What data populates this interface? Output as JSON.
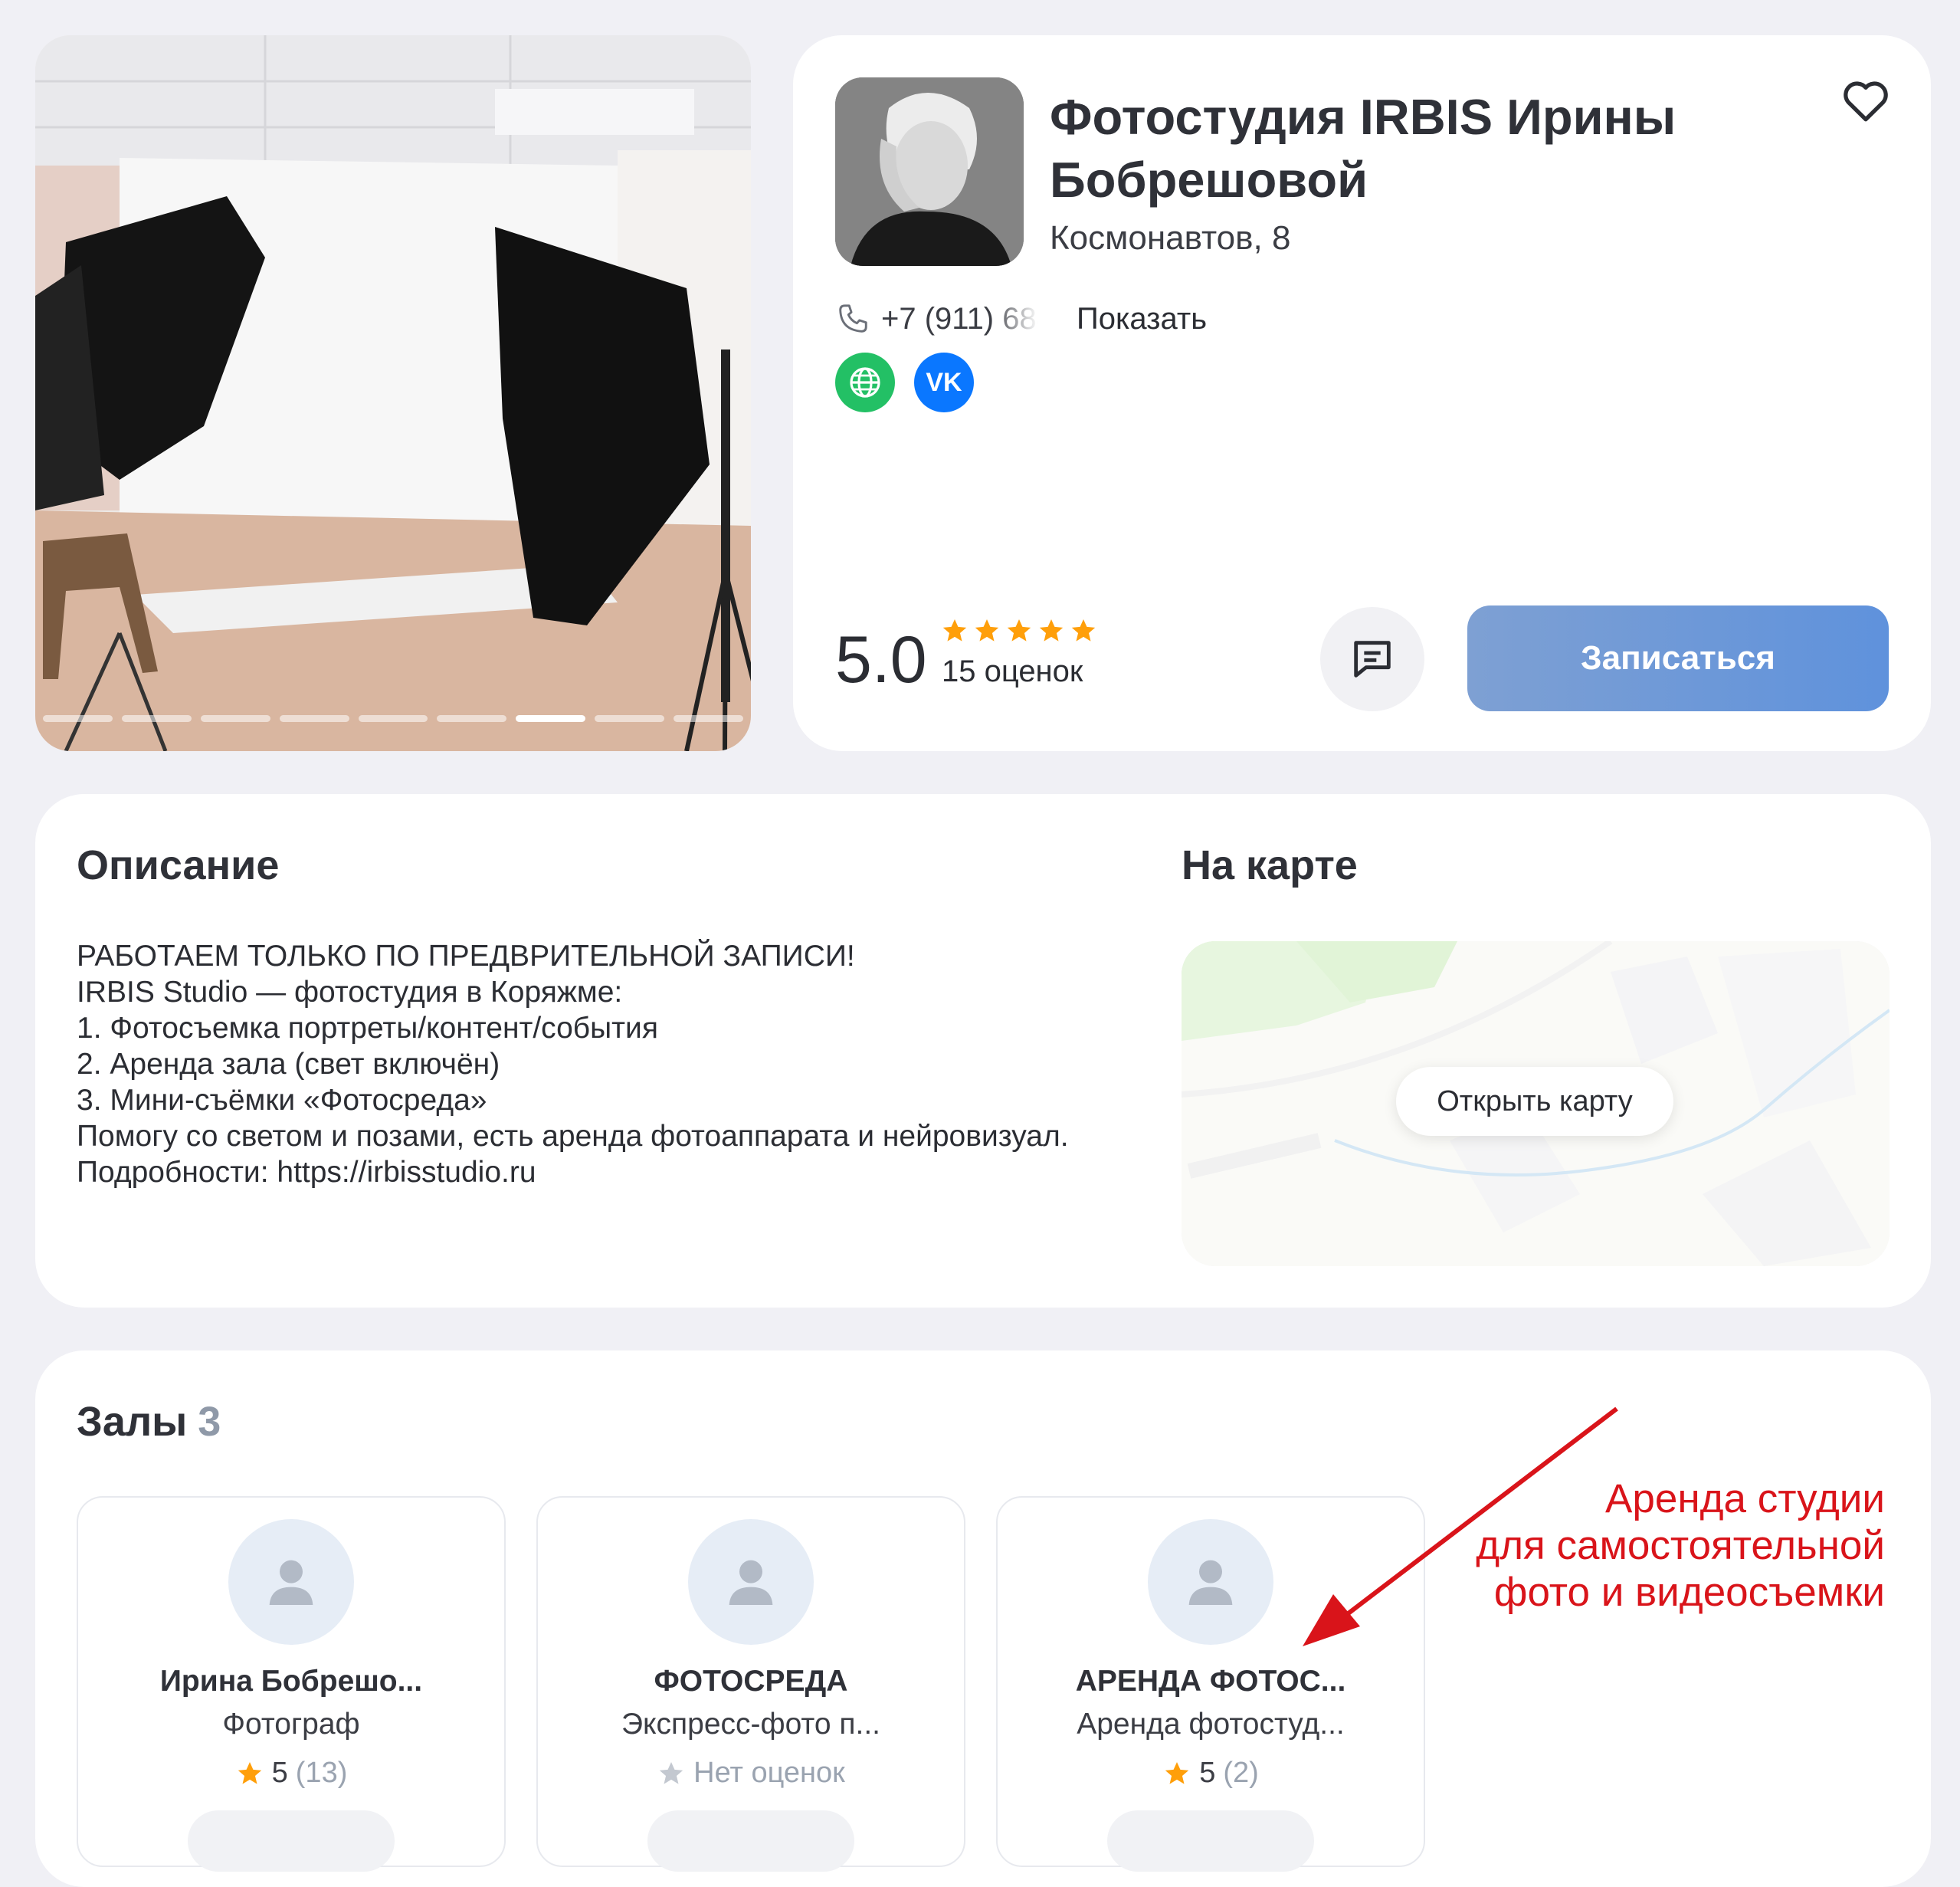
{
  "hero": {
    "slides_total": 9,
    "active_slide": 7
  },
  "studio": {
    "name": "Фотостудия IRBIS Ирины Бобрешовой",
    "address": "Космонавтов, 8",
    "phone_partial": "+7 (911) 684",
    "show_phone_label": "Показать",
    "links": [
      "globe-icon",
      "vk-icon"
    ],
    "vk_label": "VK",
    "rating": "5.0",
    "stars": 5,
    "reviews_label": "15 оценок",
    "book_label": "Записаться",
    "colors": {
      "accent": "#5f92dc",
      "star": "#ff9f0a",
      "site": "#23c065",
      "vk": "#0a77ff"
    }
  },
  "description": {
    "title": "Описание",
    "lines": [
      "РАБОТАЕМ ТОЛЬКО ПО ПРЕДВРИТЕЛЬНОЙ ЗАПИСИ!",
      "IRBIS Studio — фотостудия в Коряжме:",
      "1. Фотосъемка портреты/контент/события",
      "2. Аренда зала (свет включён)",
      "3. Мини-съёмки «Фотосреда»",
      "Помогу со светом и позами, есть аренда фотоаппарата и нейровизуал.",
      "Подробности: https://irbisstudio.ru"
    ]
  },
  "map": {
    "title": "На карте",
    "open_label": "Открыть карту"
  },
  "halls": {
    "title": "Залы",
    "count": "3",
    "items": [
      {
        "name": "Ирина Бобрешо...",
        "subtitle": "Фотограф",
        "rating": "5",
        "votes": "(13)",
        "rated": true
      },
      {
        "name": "ФОТОСРЕДА",
        "subtitle": "Экспресс-фото п...",
        "rating": "",
        "votes": "Нет оценок",
        "rated": false
      },
      {
        "name": "АРЕНДА ФОТОС...",
        "subtitle": "Аренда фотостуд...",
        "rating": "5",
        "votes": "(2)",
        "rated": true
      }
    ]
  },
  "annotation": {
    "lines": [
      "Аренда студии",
      "для самостоятельной",
      "фото и видеосъемки"
    ],
    "color": "#d9141a"
  }
}
